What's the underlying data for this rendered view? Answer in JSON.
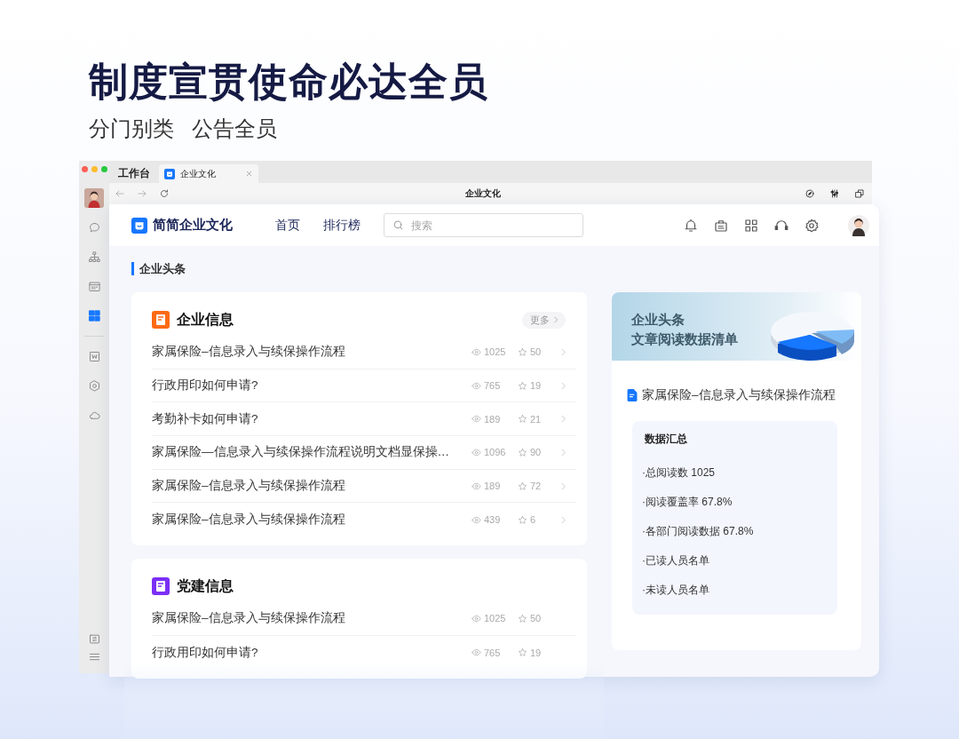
{
  "hero": {
    "title": "制度宣贯使命必达全员",
    "subtitle": [
      "分门别类",
      "公告全员"
    ]
  },
  "window": {
    "workspace": "工作台",
    "tabs": [
      {
        "label": "企业文化",
        "selected": true
      }
    ],
    "page_title": "企业文化",
    "tools": [
      {
        "kind": "compass"
      },
      {
        "kind": "sliders"
      },
      {
        "kind": "windows"
      }
    ]
  },
  "sidebar": {
    "items": [
      {
        "kind": "chat",
        "selected": false
      },
      {
        "kind": "org",
        "selected": false
      },
      {
        "kind": "calendar",
        "selected": false
      },
      {
        "kind": "grid",
        "selected": true
      },
      {
        "kind": "word",
        "selected": false
      },
      {
        "kind": "hexagon",
        "selected": false
      },
      {
        "kind": "cloud",
        "selected": false
      }
    ],
    "bottom": [
      {
        "kind": "exit"
      },
      {
        "kind": "menu"
      }
    ]
  },
  "app": {
    "name": "简简企业文化",
    "nav": [
      {
        "label": "首页"
      },
      {
        "label": "排行榜"
      }
    ],
    "search": {
      "placeholder": "搜索"
    },
    "tools": [
      {
        "kind": "bell"
      },
      {
        "kind": "briefcase"
      },
      {
        "kind": "apps"
      },
      {
        "kind": "headset"
      },
      {
        "kind": "gear"
      }
    ]
  },
  "section_title": "企业头条",
  "cards": [
    {
      "title": "企业信息",
      "color": "#ff6a13",
      "more": "更多",
      "chevrons": true,
      "rows": [
        {
          "title": "家属保险–信息录入与续保操作流程",
          "views": "1025",
          "favorites": "50"
        },
        {
          "title": "行政用印如何申请?",
          "views": "765",
          "favorites": "19"
        },
        {
          "title": "考勤补卡如何申请?",
          "views": "189",
          "favorites": "21"
        },
        {
          "title": "家属保险—信息录入与续保操作流程说明文档显保操…",
          "views": "1096",
          "favorites": "90"
        },
        {
          "title": "家属保险–信息录入与续保操作流程",
          "views": "189",
          "favorites": "72"
        },
        {
          "title": "家属保险–信息录入与续保操作流程",
          "views": "439",
          "favorites": "6"
        }
      ]
    },
    {
      "title": "党建信息",
      "color": "#7b2ff7",
      "chevrons": false,
      "rows": [
        {
          "title": "家属保险–信息录入与续保操作流程",
          "views": "1025",
          "favorites": "50"
        },
        {
          "title": "行政用印如何申请?",
          "views": "765",
          "favorites": "19"
        }
      ]
    }
  ],
  "report": {
    "banner_title": [
      "企业头条",
      "文章阅读数据清单"
    ],
    "document": "家属保险–信息录入与续保操作流程",
    "summary": {
      "title": "数据汇总",
      "items": [
        "·总阅读数 1025",
        "·阅读覆盖率 67.8%",
        "·各部门阅读数据 67.8%",
        "·已读人员名单",
        "·未读人员名单"
      ]
    }
  }
}
